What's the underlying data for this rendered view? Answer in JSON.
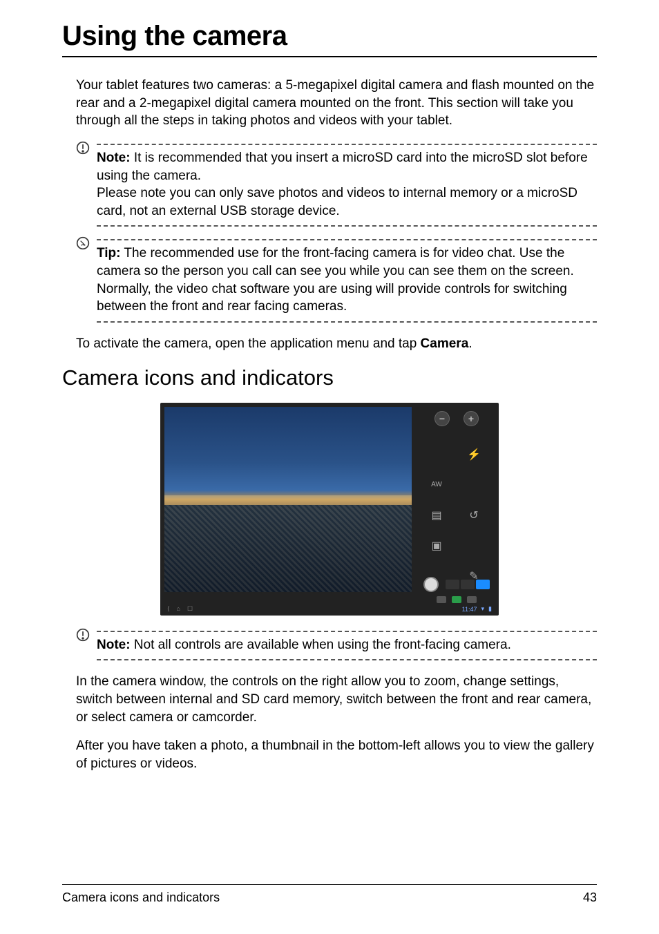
{
  "page_title": "Using the camera",
  "intro": "Your tablet features two cameras: a 5-megapixel digital camera and flash mounted on the rear and a 2-megapixel digital camera mounted on the front. This section will take you through all the steps in taking photos and videos with your tablet.",
  "note1": {
    "label": "Note:",
    "p1": " It is recommended that you insert a microSD card into the microSD slot before using the camera.",
    "p2": "Please note you can only save photos and videos to internal memory or a microSD card, not an external USB storage device."
  },
  "tip": {
    "label": "Tip:",
    "p1": " The recommended use for the front-facing camera is for video chat. Use the camera so the person you call can see you while you can see them on the screen.",
    "p2": "Normally, the video chat software you are using will provide controls for switching between the front and rear facing cameras."
  },
  "activate": {
    "prefix": "To activate the camera, open the application menu and tap ",
    "strong": "Camera",
    "suffix": "."
  },
  "section_title": "Camera icons and indicators",
  "camera_ui": {
    "zoom_out": "−",
    "zoom_in": "+",
    "flash_icon": "⚡",
    "wb_icon": "AW",
    "storage_icon": "▤",
    "switch_icon": "↺",
    "gallery_icon": "▣",
    "color_icon": "✎",
    "status_time": "11:47",
    "nav_back": "⟨",
    "nav_home": "⌂",
    "nav_recent": "☐"
  },
  "note2": {
    "label": "Note:",
    "text": " Not all controls are available when using the front-facing camera."
  },
  "para1": "In the camera window, the controls on the right allow you to zoom, change settings, switch between internal and SD card memory, switch between the front and rear camera, or select camera or camcorder.",
  "para2": "After you have taken a photo, a thumbnail in the bottom-left allows you to view the gallery of pictures or videos.",
  "footer": {
    "section": "Camera icons and indicators",
    "page": "43"
  }
}
